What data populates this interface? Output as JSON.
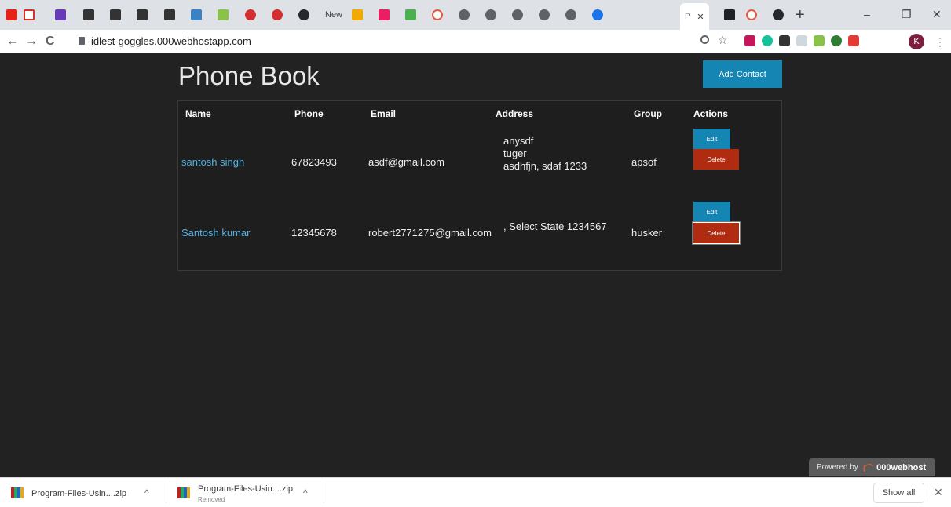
{
  "browser": {
    "tab_active_label": "P",
    "new_tab": "+",
    "minimize": "–",
    "restore": "❐",
    "close": "✕",
    "back": "←",
    "forward": "→",
    "reload": "C",
    "url": "idlest-goggles.000webhostapp.com",
    "avatar_letter": "K",
    "tab_new_label": "New",
    "accent": "#1a73e8"
  },
  "page": {
    "title": "Phone Book",
    "add_button": "Add Contact",
    "columns": [
      "Name",
      "Phone",
      "Email",
      "Address",
      "Group",
      "Actions"
    ],
    "rows": [
      {
        "name": "santosh singh",
        "phone": "67823493",
        "email": "asdf@gmail.com",
        "address": [
          "anysdf",
          "tuger",
          "asdhfjn, sdaf 1233"
        ],
        "group": "apsof",
        "edit": "Edit",
        "delete": "Delete"
      },
      {
        "name": "Santosh kumar",
        "phone": "12345678",
        "email": "robert2771275@gmail.com",
        "address": [
          ", Select State 1234567"
        ],
        "group": "husker",
        "edit": "Edit",
        "delete": "Delete"
      }
    ],
    "powered_by": "Powered by",
    "powered_brand": "000webhost",
    "colors": {
      "background": "#222222",
      "primary": "#1585b4",
      "danger": "#b02b10",
      "link": "#4fb3e3"
    }
  },
  "downloads": {
    "items": [
      {
        "name": "Program-Files-Usin....zip",
        "status": ""
      },
      {
        "name": "Program-Files-Usin....zip",
        "status": "Removed"
      }
    ],
    "show_all": "Show all",
    "close": "✕",
    "chevron": "^"
  }
}
